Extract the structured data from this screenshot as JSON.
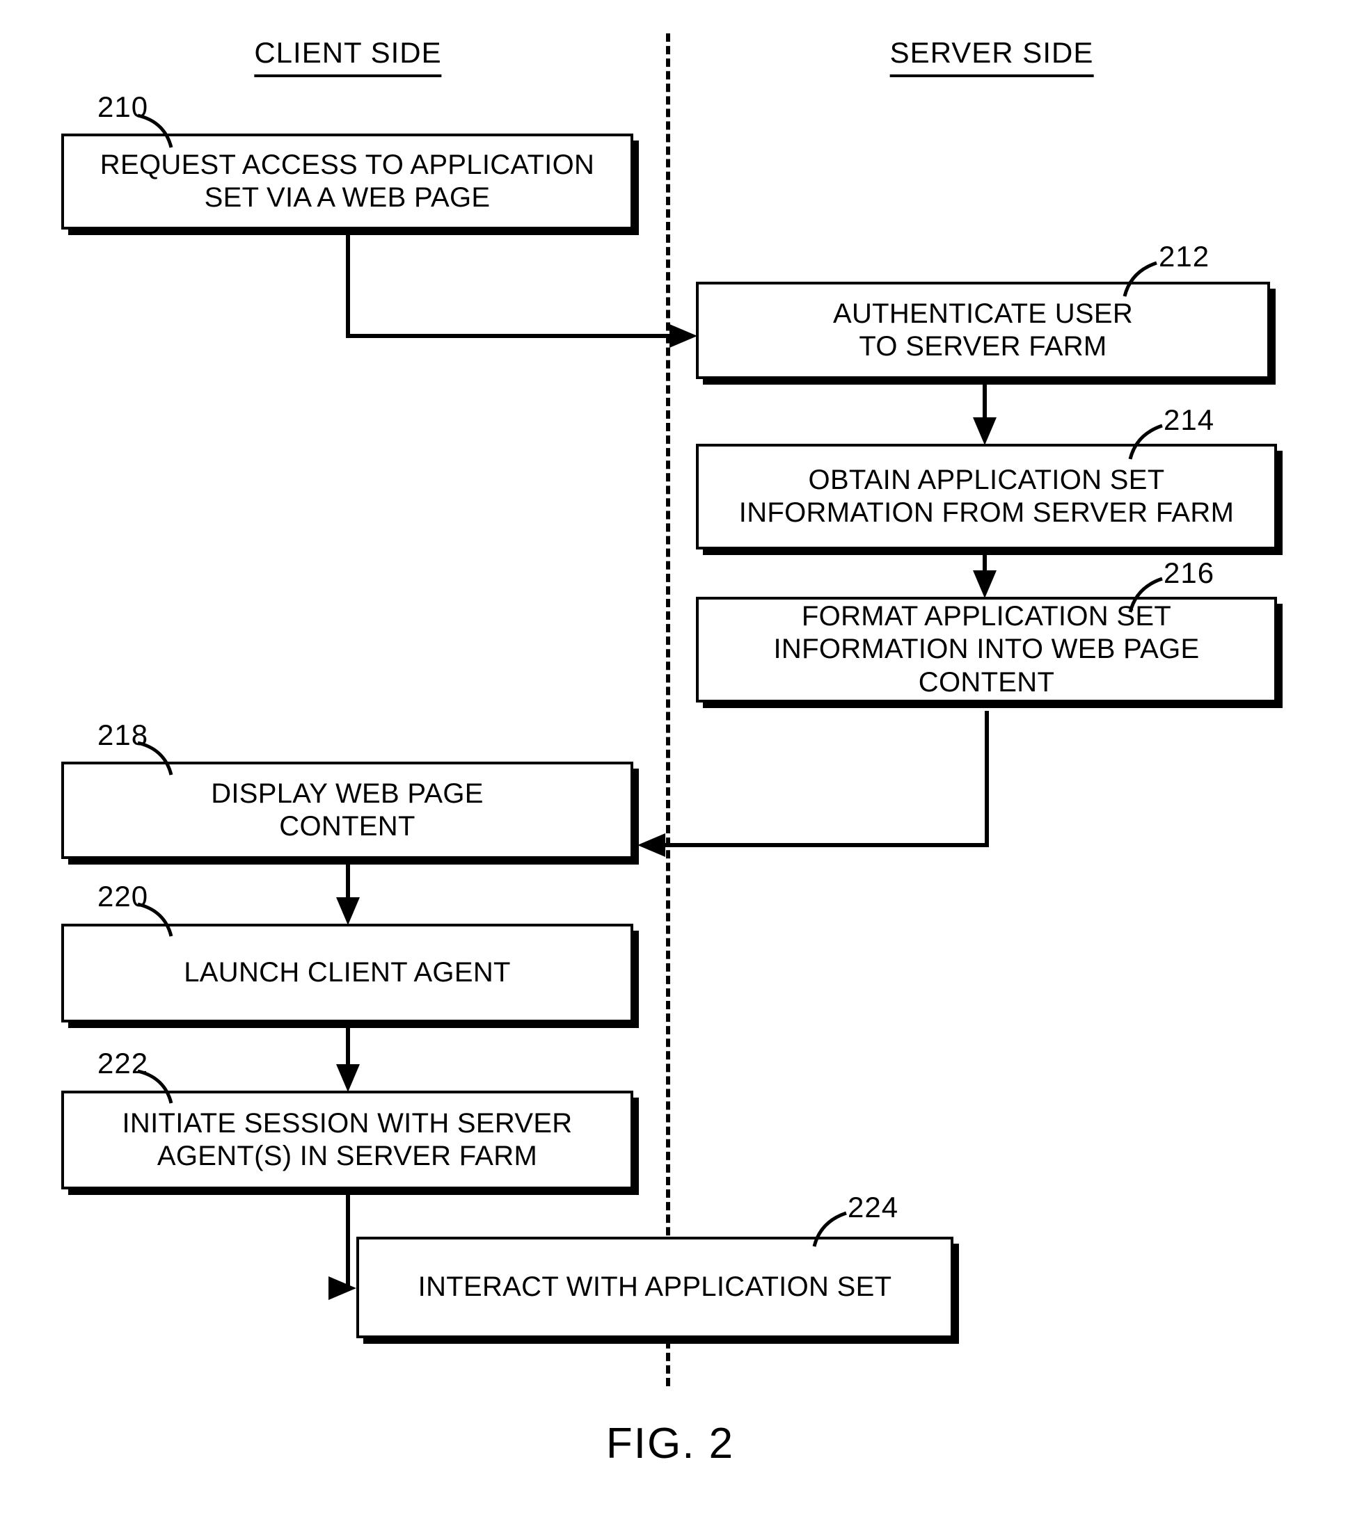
{
  "figure": {
    "caption": "FIG. 2",
    "headers": [
      {
        "id": "client",
        "label": "CLIENT SIDE"
      },
      {
        "id": "server",
        "label": "SERVER SIDE"
      }
    ]
  },
  "steps": [
    {
      "ref": "210",
      "side": "client",
      "line1": "REQUEST ACCESS TO APPLICATION",
      "line2": "SET VIA A WEB PAGE",
      "text": "REQUEST ACCESS TO APPLICATION\nSET VIA A WEB PAGE"
    },
    {
      "ref": "212",
      "side": "server",
      "line1": "AUTHENTICATE USER",
      "line2": "TO SERVER FARM",
      "text": "AUTHENTICATE USER\nTO SERVER FARM"
    },
    {
      "ref": "214",
      "side": "server",
      "line1": "OBTAIN APPLICATION SET",
      "line2": "INFORMATION FROM SERVER FARM",
      "text": "OBTAIN APPLICATION SET\nINFORMATION FROM SERVER FARM"
    },
    {
      "ref": "216",
      "side": "server",
      "line1": "FORMAT APPLICATION SET",
      "line2": "INFORMATION INTO WEB PAGE CONTENT",
      "text": "FORMAT APPLICATION SET\nINFORMATION INTO WEB PAGE CONTENT"
    },
    {
      "ref": "218",
      "side": "client",
      "line1": "DISPLAY WEB PAGE",
      "line2": "CONTENT",
      "text": "DISPLAY WEB PAGE\nCONTENT"
    },
    {
      "ref": "220",
      "side": "client",
      "line1": "LAUNCH CLIENT AGENT",
      "line2": "",
      "text": "LAUNCH CLIENT AGENT"
    },
    {
      "ref": "222",
      "side": "client",
      "line1": "INITIATE SESSION WITH SERVER",
      "line2": "AGENT(S) IN SERVER FARM",
      "text": "INITIATE SESSION WITH SERVER\nAGENT(S) IN SERVER FARM"
    },
    {
      "ref": "224",
      "side": "both",
      "line1": "INTERACT WITH APPLICATION SET",
      "line2": "",
      "text": "INTERACT WITH APPLICATION SET"
    }
  ],
  "colors": {
    "ink": "#000000",
    "paper": "#ffffff"
  }
}
